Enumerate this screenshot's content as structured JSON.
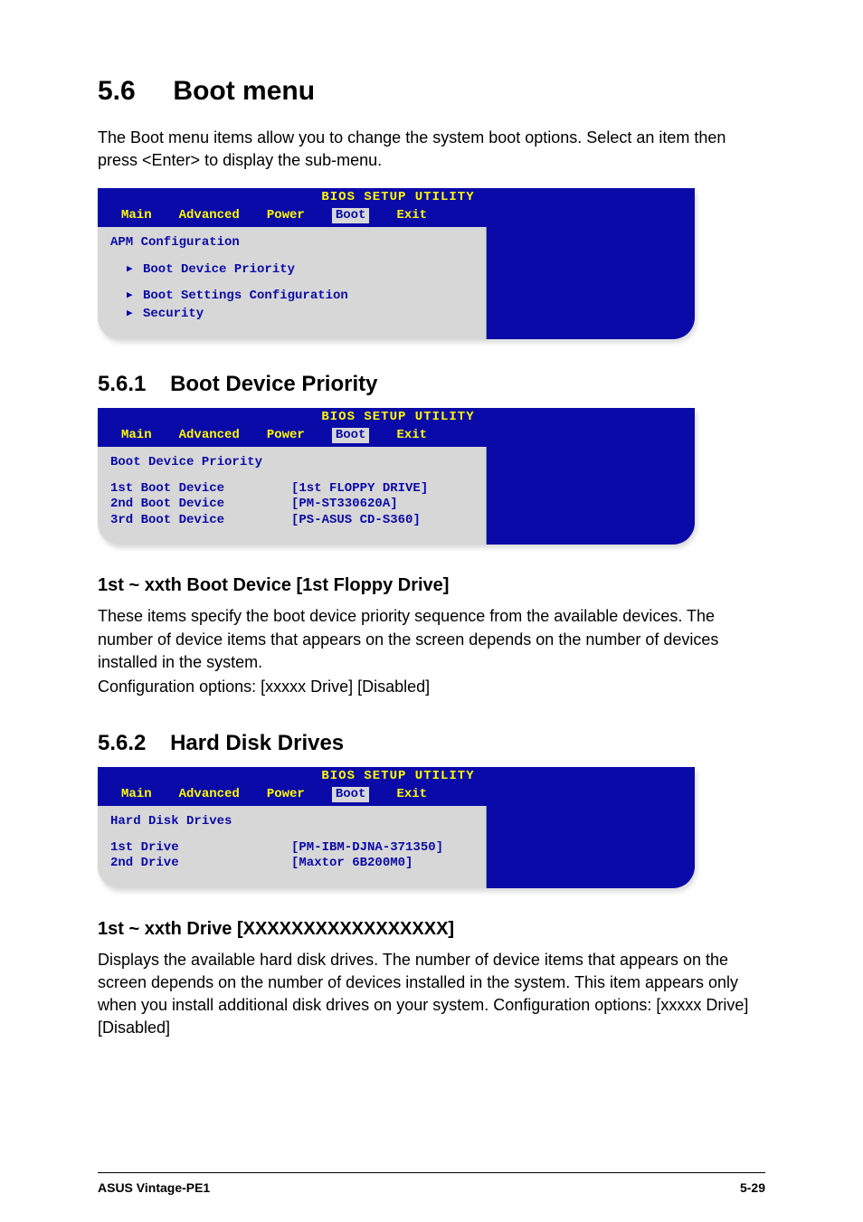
{
  "page": {
    "section_number": "5.6",
    "section_title": "Boot menu",
    "intro_para": "The Boot menu items allow you to change the system boot options. Select an item then press <Enter> to display the sub-menu."
  },
  "bios_common": {
    "utility_title": "BIOS SETUP UTILITY",
    "tabs": {
      "main": "Main",
      "advanced": "Advanced",
      "power": "Power",
      "boot": "Boot",
      "exit": "Exit"
    }
  },
  "bios1": {
    "heading": "APM Configuration",
    "items": [
      "Boot Device Priority",
      "Boot Settings Configuration",
      "Security"
    ]
  },
  "s561": {
    "number": "5.6.1",
    "title": "Boot Device Priority"
  },
  "bios2": {
    "heading": "Boot Device Priority",
    "rows": [
      {
        "k": "1st Boot Device",
        "v": "[1st FLOPPY DRIVE]"
      },
      {
        "k": "2nd Boot Device",
        "v": "[PM-ST330620A]"
      },
      {
        "k": "3rd Boot Device",
        "v": "[PS-ASUS CD-S360]"
      }
    ]
  },
  "s561_sub": {
    "title": "1st ~ xxth Boot Device [1st Floppy Drive]",
    "para1": "These items specify the boot device priority sequence from the available devices. The number of device items that appears on the screen depends on the number of devices installed in the system.",
    "para2": "Configuration options: [xxxxx Drive] [Disabled]"
  },
  "s562": {
    "number": "5.6.2",
    "title": "Hard Disk Drives"
  },
  "bios3": {
    "heading": "Hard Disk Drives",
    "rows": [
      {
        "k": "1st Drive",
        "v": "[PM-IBM-DJNA-371350]"
      },
      {
        "k": "2nd Drive",
        "v": "[Maxtor 6B200M0]"
      }
    ]
  },
  "s562_sub": {
    "title": "1st ~ xxth Drive [XXXXXXXXXXXXXXXXX]",
    "para": "Displays the available hard disk drives. The number of device items that appears on the screen depends on the number of devices installed in the system. This item appears only when you install additional disk drives on your system. Configuration options: [xxxxx Drive] [Disabled]"
  },
  "footer": {
    "left": "ASUS Vintage-PE1",
    "right": "5-29"
  }
}
